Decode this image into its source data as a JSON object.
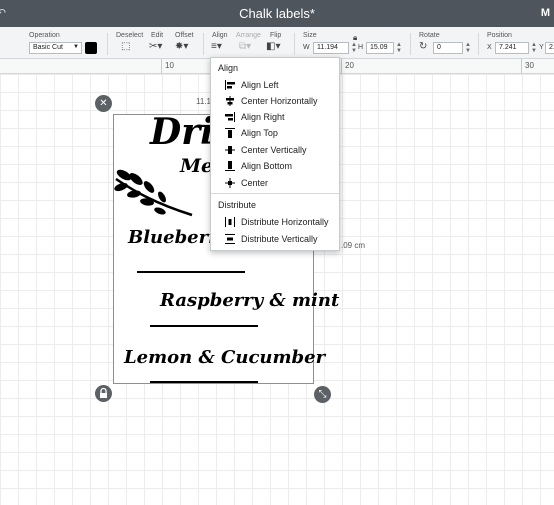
{
  "title_bar": {
    "title": "Chalk labels*",
    "right_tag": "M"
  },
  "toolbar": {
    "operation": {
      "label": "Operation",
      "value": "Basic Cut",
      "color": "#000000"
    },
    "deselect_label": "Deselect",
    "edit_label": "Edit",
    "offset_label": "Offset",
    "align_label": "Align",
    "arrange_label": "Arrange",
    "flip_label": "Flip",
    "size": {
      "label": "Size",
      "w_label": "W",
      "w_value": "11.194",
      "h_label": "H",
      "h_value": "15.09"
    },
    "rotate": {
      "label": "Rotate",
      "value": "0"
    },
    "position": {
      "label": "Position",
      "x_label": "X",
      "x_value": "7.241",
      "y_label": "Y",
      "y_value": "2."
    }
  },
  "ruler": {
    "marks": [
      "10",
      "20",
      "30"
    ]
  },
  "canvas": {
    "width_readout": "11.19",
    "height_readout": ".09 cm",
    "text_items": [
      "Dri",
      "Men",
      "Blueberry",
      "Raspberry & mint",
      "Lemon & Cucumber"
    ]
  },
  "align_menu": {
    "align_heading": "Align",
    "align_items": [
      {
        "label": "Align Left",
        "icon": "align-left-icon"
      },
      {
        "label": "Center Horizontally",
        "icon": "center-horizontally-icon"
      },
      {
        "label": "Align Right",
        "icon": "align-right-icon"
      },
      {
        "label": "Align Top",
        "icon": "align-top-icon"
      },
      {
        "label": "Center Vertically",
        "icon": "center-vertically-icon"
      },
      {
        "label": "Align Bottom",
        "icon": "align-bottom-icon"
      },
      {
        "label": "Center",
        "icon": "center-icon"
      }
    ],
    "distribute_heading": "Distribute",
    "distribute_items": [
      {
        "label": "Distribute Horizontally",
        "icon": "distribute-horizontally-icon"
      },
      {
        "label": "Distribute Vertically",
        "icon": "distribute-vertically-icon"
      }
    ]
  }
}
